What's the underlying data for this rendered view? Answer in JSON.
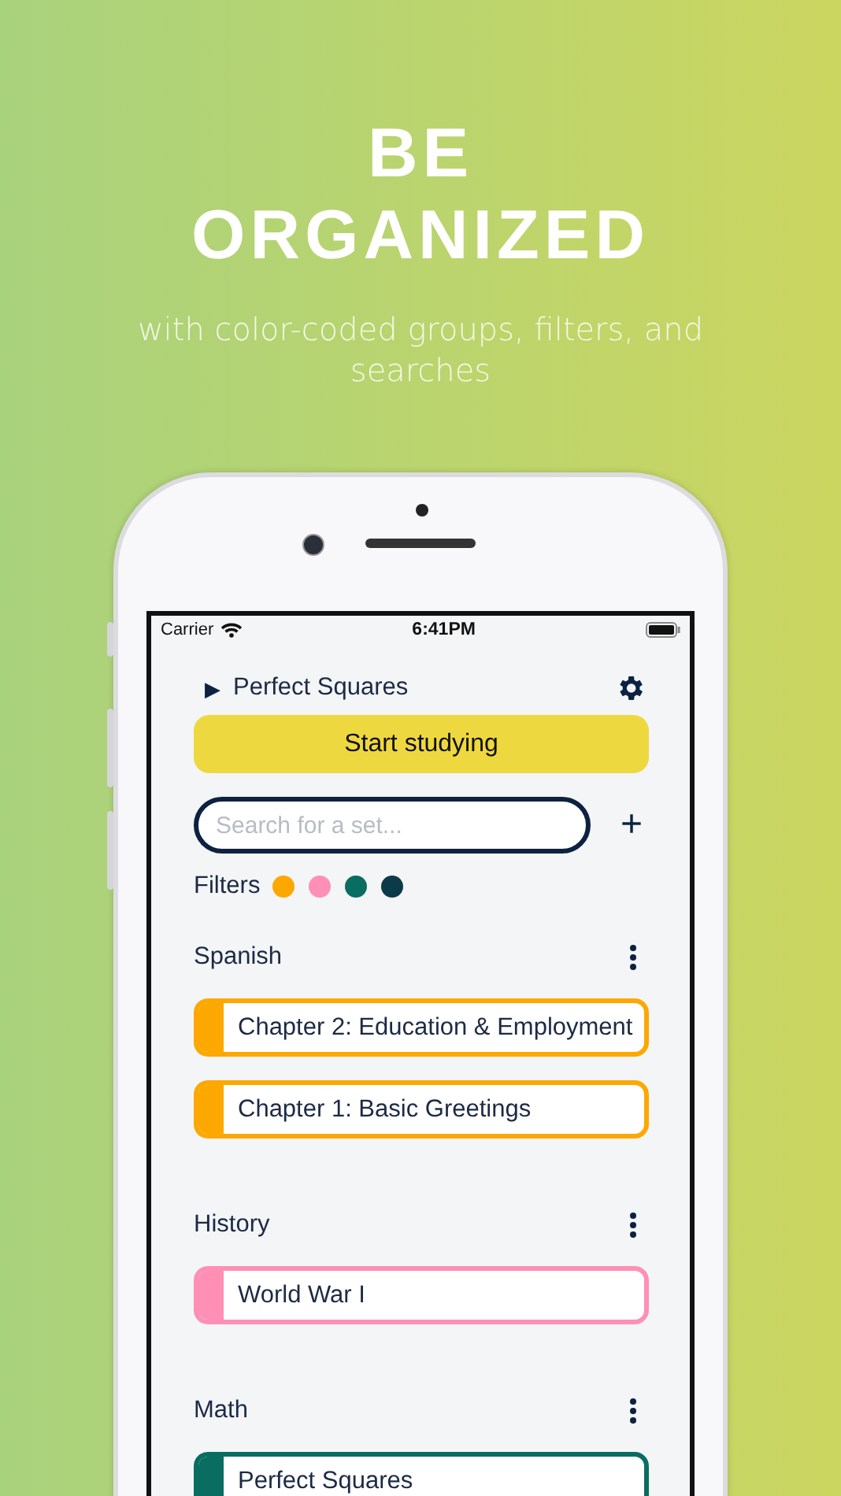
{
  "promo": {
    "headline": "BE ORGANIZED",
    "subtitle": "with color-coded groups, filters, and searches"
  },
  "status_bar": {
    "carrier": "Carrier",
    "time": "6:41PM"
  },
  "current_set": {
    "play_icon": "▶",
    "title": "Perfect Squares"
  },
  "start_button": "Start studying",
  "search": {
    "placeholder": "Search for a set...",
    "add_icon": "+"
  },
  "filters": {
    "label": "Filters",
    "dots": [
      {
        "color": "#fca800"
      },
      {
        "color": "#ff8fb5"
      },
      {
        "color": "#0a6d62"
      },
      {
        "color": "#0b3b48"
      }
    ]
  },
  "groups": [
    {
      "name": "Spanish",
      "sets": [
        {
          "title": "Chapter 2: Education & Employment",
          "color": "#fca800"
        },
        {
          "title": "Chapter 1: Basic Greetings",
          "color": "#fca800"
        }
      ]
    },
    {
      "name": "History",
      "sets": [
        {
          "title": "World War I",
          "color": "#ff8fb5"
        }
      ]
    },
    {
      "name": "Math",
      "sets": [
        {
          "title": "Perfect Squares",
          "color": "#0a6d62"
        }
      ]
    }
  ]
}
